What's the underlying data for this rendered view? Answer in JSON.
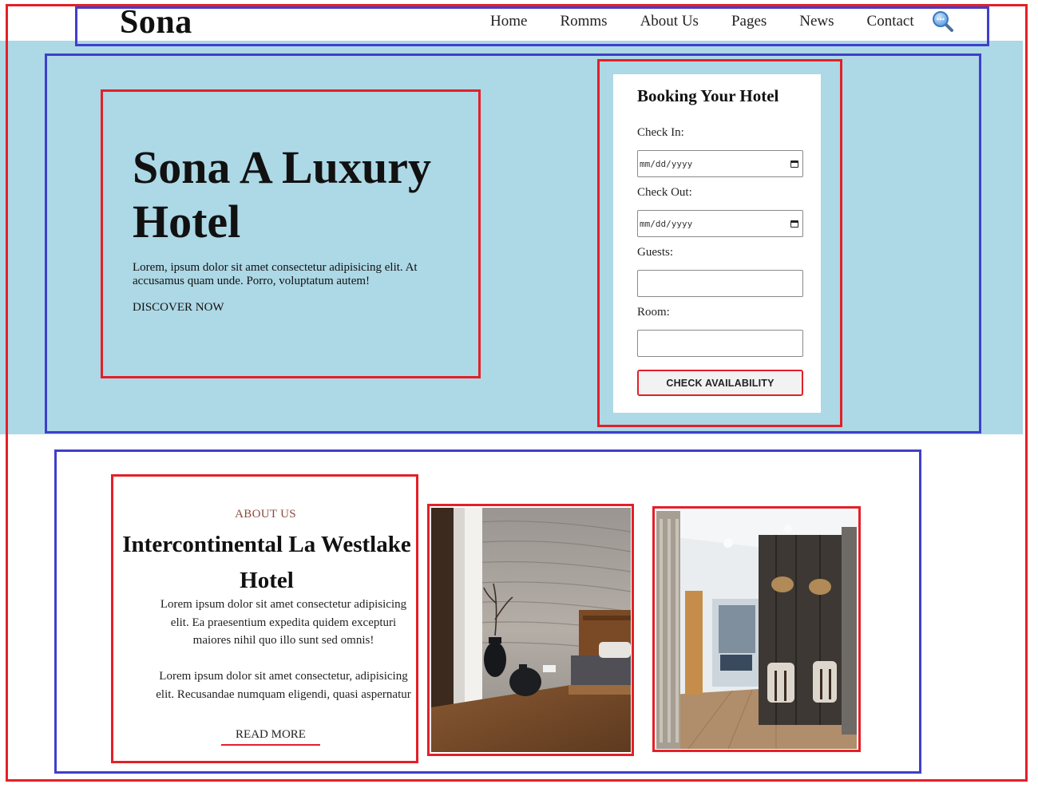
{
  "header": {
    "logo": "Sona",
    "nav": [
      "Home",
      "Romms",
      "About Us",
      "Pages",
      "News",
      "Contact"
    ],
    "search_icon": "search-icon"
  },
  "hero": {
    "title": "Sona A Luxury Hotel",
    "description": "Lorem, ipsum dolor sit amet consectetur adipisicing elit. At accusamus quam unde. Porro, voluptatum autem!",
    "cta": "DISCOVER NOW",
    "background": "#add8e6"
  },
  "booking": {
    "title": "Booking Your Hotel",
    "check_in_label": "Check In:",
    "check_in_value": "mm/dd/yyyy",
    "check_out_label": "Check Out:",
    "check_out_value": "mm/dd/yyyy",
    "guests_label": "Guests:",
    "guests_value": "",
    "room_label": "Room:",
    "room_value": "",
    "button": "CHECK AVAILABILITY",
    "calendar_icon": "calendar-icon"
  },
  "about": {
    "kicker": "ABOUT US",
    "title": "Intercontinental La Westlake Hotel",
    "paragraph1": "Lorem ipsum dolor sit amet consectetur adipisicing elit. Ea praesentium expedita quidem excepturi maiores nihil quo illo sunt sed omnis!",
    "paragraph2": "Lorem ipsum dolor sit amet consectetur, adipisicing elit. Recusandae numquam eligendi, quasi aspernatur",
    "read_more": "READ MORE"
  },
  "colors": {
    "accent_red": "#e32028",
    "outline_blue": "#3f3fcc",
    "kicker": "#8a4a3a"
  }
}
